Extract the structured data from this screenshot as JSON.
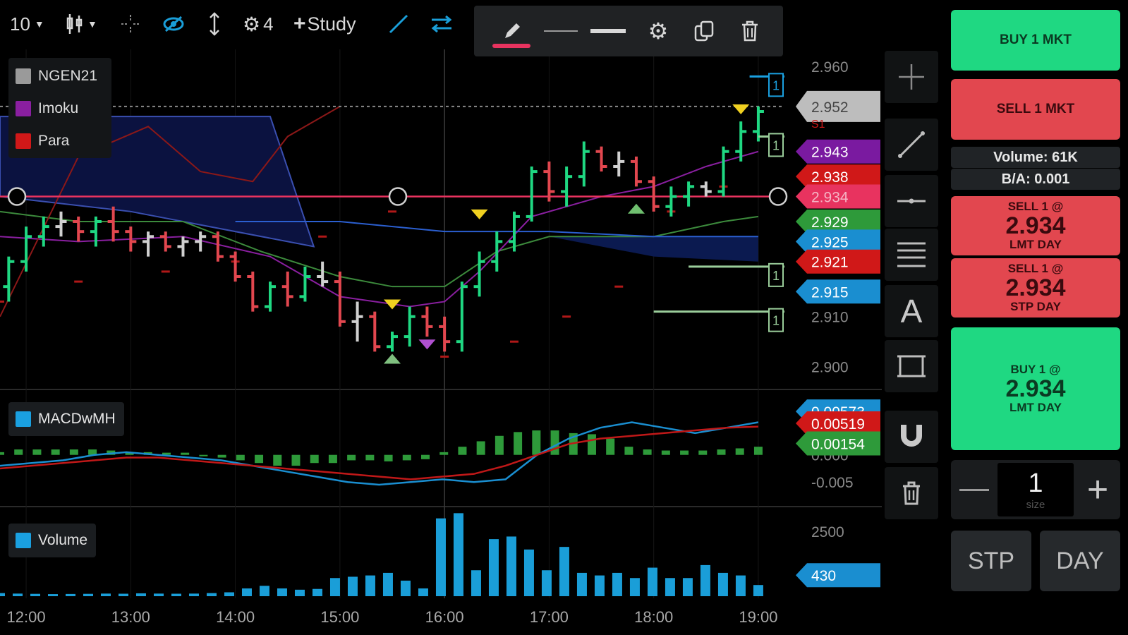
{
  "toolbar": {
    "interval": "10",
    "study_count": "4",
    "study_label": "Study"
  },
  "legend": [
    {
      "name": "NGEN21",
      "color": "#9a9a9a"
    },
    {
      "name": "Imoku",
      "color": "#8a1fa0"
    },
    {
      "name": "Para",
      "color": "#d01818"
    }
  ],
  "indicators": {
    "macd_label": "MACDwMH",
    "volume_label": "Volume",
    "color": "#1aa0e0"
  },
  "price_axis": {
    "ticks": [
      "2.960",
      "2.910",
      "2.900"
    ],
    "tags": [
      {
        "value": "2.952",
        "color": "#bdbdbd",
        "text_color": "#444444",
        "sub": "S1"
      },
      {
        "value": "2.943",
        "color": "#7a1aa0",
        "text_color": "#ffffff"
      },
      {
        "value": "2.938",
        "color": "#d01818",
        "text_color": "#ffffff"
      },
      {
        "value": "2.934",
        "color": "#e8335f",
        "text_color": "#f5b5c5"
      },
      {
        "value": "2.929",
        "color": "#2e9a3a",
        "text_color": "#ffffff"
      },
      {
        "value": "2.925",
        "color": "#1a8ed0",
        "text_color": "#ffffff"
      },
      {
        "value": "2.921",
        "color": "#d01818",
        "text_color": "#ffffff"
      },
      {
        "value": "2.915",
        "color": "#1a8ed0",
        "text_color": "#ffffff"
      }
    ]
  },
  "macd_axis": {
    "ticks": [
      "0.000",
      "-0.005"
    ],
    "tags": [
      {
        "value": "0.00573",
        "color": "#1a8ed0"
      },
      {
        "value": "0.00519",
        "color": "#d01818"
      },
      {
        "value": "0.00154",
        "color": "#2e9a3a"
      }
    ]
  },
  "volume_axis": {
    "ticks": [
      "2500"
    ],
    "tag": {
      "value": "430",
      "color": "#1a8ed0"
    }
  },
  "time_axis": [
    "12:00",
    "13:00",
    "14:00",
    "15:00",
    "16:00",
    "17:00",
    "18:00",
    "19:00"
  ],
  "order_markers": [
    "1",
    "1",
    "1",
    "1"
  ],
  "trade_panel": {
    "buy_mkt": "BUY 1 MKT",
    "sell_mkt": "SELL 1 MKT",
    "volume": "Volume: 61K",
    "bid_ask": "B/A: 0.001",
    "sell_lmt": {
      "line1": "SELL 1 @",
      "price": "2.934",
      "line3": "LMT DAY"
    },
    "sell_stp": {
      "line1": "SELL 1 @",
      "price": "2.934",
      "line3": "STP DAY"
    },
    "buy_lmt": {
      "line1": "BUY 1 @",
      "price": "2.934",
      "line3": "LMT DAY"
    },
    "qty": "1",
    "qty_label": "size",
    "stp": "STP",
    "day": "DAY"
  },
  "chart_data": {
    "type": "candlestick",
    "time_range": [
      "11:45",
      "19:15"
    ],
    "price_ylim": [
      2.896,
      2.962
    ],
    "price_candles": [
      [
        2.918,
        2.921,
        2.914,
        2.915,
        "11:40"
      ],
      [
        2.916,
        2.922,
        2.913,
        2.921,
        "11:50"
      ],
      [
        2.921,
        2.928,
        2.919,
        2.926,
        "12:00"
      ],
      [
        2.926,
        2.93,
        2.924,
        2.928,
        "12:10"
      ],
      [
        2.928,
        2.931,
        2.926,
        2.929,
        "12:20"
      ],
      [
        2.929,
        2.93,
        2.925,
        2.927,
        "12:30"
      ],
      [
        2.927,
        2.93,
        2.924,
        2.929,
        "12:40"
      ],
      [
        2.929,
        2.932,
        2.925,
        2.927,
        "12:50"
      ],
      [
        2.927,
        2.928,
        2.923,
        2.925,
        "13:00"
      ],
      [
        2.925,
        2.927,
        2.922,
        2.926,
        "13:10"
      ],
      [
        2.926,
        2.927,
        2.923,
        2.924,
        "13:20"
      ],
      [
        2.924,
        2.926,
        2.922,
        2.925,
        "13:30"
      ],
      [
        2.925,
        2.927,
        2.923,
        2.926,
        "13:40"
      ],
      [
        2.926,
        2.927,
        2.921,
        2.922,
        "13:50"
      ],
      [
        2.922,
        2.923,
        2.917,
        2.918,
        "14:00"
      ],
      [
        2.918,
        2.919,
        2.911,
        2.912,
        "14:10"
      ],
      [
        2.912,
        2.917,
        2.911,
        2.916,
        "14:20"
      ],
      [
        2.916,
        2.919,
        2.912,
        2.914,
        "14:30"
      ],
      [
        2.914,
        2.92,
        2.913,
        2.918,
        "14:40"
      ],
      [
        2.918,
        2.921,
        2.916,
        2.917,
        "14:50"
      ],
      [
        2.917,
        2.919,
        2.908,
        2.909,
        "15:00"
      ],
      [
        2.909,
        2.913,
        2.905,
        2.91,
        "15:10"
      ],
      [
        2.91,
        2.911,
        2.903,
        2.904,
        "15:20"
      ],
      [
        2.904,
        2.907,
        2.903,
        2.906,
        "15:30"
      ],
      [
        2.906,
        2.912,
        2.904,
        2.91,
        "15:40"
      ],
      [
        2.91,
        2.912,
        2.906,
        2.908,
        "15:50"
      ],
      [
        2.908,
        2.91,
        2.903,
        2.905,
        "16:00"
      ],
      [
        2.905,
        2.917,
        2.903,
        2.916,
        "16:10"
      ],
      [
        2.916,
        2.923,
        2.914,
        2.921,
        "16:20"
      ],
      [
        2.921,
        2.927,
        2.919,
        2.925,
        "16:30"
      ],
      [
        2.925,
        2.931,
        2.923,
        2.93,
        "16:40"
      ],
      [
        2.93,
        2.94,
        2.929,
        2.939,
        "16:50"
      ],
      [
        2.939,
        2.941,
        2.933,
        2.935,
        "17:00"
      ],
      [
        2.935,
        2.94,
        2.932,
        2.938,
        "17:10"
      ],
      [
        2.938,
        2.945,
        2.936,
        2.943,
        "17:20"
      ],
      [
        2.943,
        2.944,
        2.939,
        2.94,
        "17:30"
      ],
      [
        2.94,
        2.943,
        2.938,
        2.941,
        "17:40"
      ],
      [
        2.941,
        2.942,
        2.936,
        2.937,
        "17:50"
      ],
      [
        2.937,
        2.938,
        2.931,
        2.932,
        "18:00"
      ],
      [
        2.932,
        2.936,
        2.93,
        2.934,
        "18:10"
      ],
      [
        2.934,
        2.937,
        2.932,
        2.936,
        "18:20"
      ],
      [
        2.936,
        2.937,
        2.934,
        2.935,
        "18:30"
      ],
      [
        2.935,
        2.944,
        2.934,
        2.943,
        "18:40"
      ],
      [
        2.943,
        2.949,
        2.941,
        2.947,
        "18:50"
      ],
      [
        2.947,
        2.952,
        2.945,
        2.951,
        "19:00"
      ]
    ],
    "horizontal_lines": [
      2.934,
      2.952
    ],
    "macd_ylim": [
      -0.009,
      0.011
    ],
    "macd_series": [
      {
        "values": [
          -0.002,
          -0.0015,
          -0.001,
          0.0,
          0.0005,
          0.0,
          -0.0005,
          -0.001,
          -0.002,
          -0.003,
          -0.004,
          -0.005,
          -0.0055,
          -0.005,
          -0.0045,
          -0.005,
          -0.0045,
          0.0,
          0.003,
          0.005,
          0.006,
          0.005,
          0.004,
          0.005,
          0.006
        ]
      },
      {
        "values": [
          -0.0025,
          -0.002,
          -0.0015,
          -0.001,
          -0.0005,
          -0.0005,
          -0.001,
          -0.0015,
          -0.002,
          -0.0025,
          -0.003,
          -0.0035,
          -0.004,
          -0.0045,
          -0.004,
          -0.0035,
          -0.002,
          0.0,
          0.002,
          0.003,
          0.0035,
          0.004,
          0.0045,
          0.005,
          0.0052
        ]
      }
    ],
    "macd_hist": [
      0.0005,
      0.001,
      0.001,
      0.001,
      0.001,
      0.001,
      0.0008,
      0.0005,
      0.0005,
      0.0004,
      0.0004,
      -0.0002,
      -0.0005,
      -0.001,
      -0.0015,
      -0.002,
      -0.002,
      -0.0015,
      -0.0015,
      -0.001,
      -0.001,
      -0.0012,
      -0.001,
      -0.0008,
      0.0005,
      0.0015,
      0.0025,
      0.0035,
      0.0042,
      0.0045,
      0.0045,
      0.004,
      0.0038,
      0.003,
      0.0015,
      0.001,
      0.0008,
      0.0008,
      0.0008,
      0.001,
      0.0012,
      0.0015
    ],
    "volume_ylim": [
      0,
      3400
    ],
    "volume": [
      120,
      100,
      90,
      80,
      85,
      90,
      100,
      95,
      110,
      100,
      95,
      100,
      120,
      150,
      300,
      400,
      300,
      250,
      280,
      700,
      750,
      800,
      900,
      600,
      300,
      3000,
      3200,
      1000,
      2200,
      2300,
      1800,
      1000,
      1900,
      900,
      800,
      900,
      700,
      1100,
      700,
      700,
      1200,
      900,
      800,
      430
    ]
  }
}
